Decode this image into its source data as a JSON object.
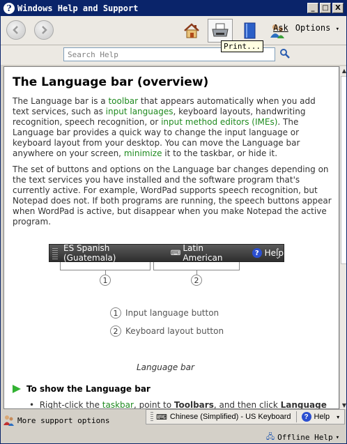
{
  "window": {
    "title": "Windows Help and Support",
    "min_glyph": "_",
    "max_glyph": "□",
    "close_glyph": "X"
  },
  "toolbar": {
    "ask_label": "Ask",
    "options_label": "Options",
    "print_tooltip": "Print..."
  },
  "search": {
    "placeholder": "Search Help"
  },
  "article": {
    "title": "The Language bar (overview)",
    "p1": {
      "a": "The Language bar is a ",
      "link1": "toolbar",
      "b": " that appears automatically when you add text services, such as ",
      "link2": "input languages",
      "c": ", keyboard layouts, handwriting recognition, speech recognition, or ",
      "link3": "input method editors (IMEs)",
      "d": ". The Language bar provides a quick way to change the input language or keyboard layout from your desktop. You can move the Language bar anywhere on your screen, ",
      "link4": "minimize",
      "e": " it to the taskbar, or hide it."
    },
    "p2": "The set of buttons and options on the Language bar changes depending on the text services you have installed and the software program that's currently active. For example, WordPad supports speech recognition, but Notepad does not. If both programs are running, the speech buttons appear when WordPad is active, but disappear when you make Notepad the active program.",
    "figure": {
      "lang_label": "ES Spanish (Guatemala)",
      "keyboard_label": "Latin American",
      "help_label": "Help",
      "callout1": "1",
      "callout2": "2",
      "legend1": "Input language button",
      "legend2": "Keyboard layout button",
      "caption": "Language bar"
    },
    "section_title": "To show the Language bar",
    "bullet": {
      "a": "Right-click the ",
      "link": "taskbar",
      "b": ", point to ",
      "bold1": "Toolbars",
      "c": ", and then click ",
      "bold2": "Language"
    }
  },
  "status": {
    "more_support": "More support options",
    "offline_help": "Offline Help"
  },
  "system_langbar": {
    "language": "Chinese (Simplified) - US Keyboard",
    "help": "Help"
  }
}
